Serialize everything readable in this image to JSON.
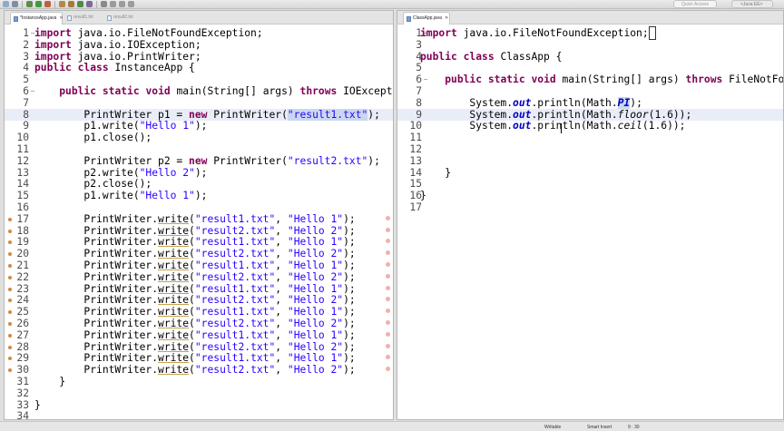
{
  "toolbar": {
    "quick_access_placeholder": "Quick Access",
    "perspective_label": "<Java EE>"
  },
  "left_editor": {
    "tabs": [
      {
        "label": "*InstanceApp.java",
        "active": true,
        "closable": true
      },
      {
        "label": "result1.txt",
        "active": false,
        "closable": false
      },
      {
        "label": "result2.txt",
        "active": false,
        "closable": false
      }
    ],
    "lines": [
      {
        "n": "1",
        "fold": "-",
        "hl": false,
        "ann": false,
        "mark": false,
        "tokens": [
          {
            "t": "import",
            "c": "kw"
          },
          {
            "t": " java.io.FileNotFoundException;"
          }
        ]
      },
      {
        "n": "2",
        "fold": "",
        "hl": false,
        "ann": false,
        "mark": false,
        "tokens": [
          {
            "t": "import",
            "c": "kw"
          },
          {
            "t": " java.io.IOException;"
          }
        ]
      },
      {
        "n": "3",
        "fold": "",
        "hl": false,
        "ann": false,
        "mark": false,
        "tokens": [
          {
            "t": "import",
            "c": "kw"
          },
          {
            "t": " java.io.PrintWriter;"
          }
        ]
      },
      {
        "n": "4",
        "fold": "",
        "hl": false,
        "ann": false,
        "mark": false,
        "tokens": [
          {
            "t": "public",
            "c": "kw"
          },
          {
            "t": " "
          },
          {
            "t": "class",
            "c": "kw"
          },
          {
            "t": " InstanceApp {"
          }
        ]
      },
      {
        "n": "5",
        "fold": "",
        "hl": false,
        "ann": false,
        "mark": false,
        "tokens": []
      },
      {
        "n": "6",
        "fold": "-",
        "hl": false,
        "ann": false,
        "mark": false,
        "tokens": [
          {
            "t": "    "
          },
          {
            "t": "public",
            "c": "kw"
          },
          {
            "t": " "
          },
          {
            "t": "static",
            "c": "kw"
          },
          {
            "t": " "
          },
          {
            "t": "void",
            "c": "kw"
          },
          {
            "t": " main(String[] args) "
          },
          {
            "t": "throws",
            "c": "kw"
          },
          {
            "t": " IOExcepti"
          }
        ]
      },
      {
        "n": "7",
        "fold": "",
        "hl": false,
        "ann": false,
        "mark": false,
        "tokens": []
      },
      {
        "n": "8",
        "fold": "",
        "hl": true,
        "ann": false,
        "mark": false,
        "tokens": [
          {
            "t": "        PrintWriter p1 = "
          },
          {
            "t": "new",
            "c": "kw"
          },
          {
            "t": " PrintWriter("
          },
          {
            "t": "\"result1.txt\"",
            "c": "str sel"
          },
          {
            "t": ");"
          }
        ]
      },
      {
        "n": "9",
        "fold": "",
        "hl": false,
        "ann": false,
        "mark": false,
        "tokens": [
          {
            "t": "        p1.write("
          },
          {
            "t": "\"Hello 1\"",
            "c": "str"
          },
          {
            "t": ");"
          }
        ]
      },
      {
        "n": "10",
        "fold": "",
        "hl": false,
        "ann": false,
        "mark": false,
        "tokens": [
          {
            "t": "        p1.close();"
          }
        ]
      },
      {
        "n": "11",
        "fold": "",
        "hl": false,
        "ann": false,
        "mark": false,
        "tokens": []
      },
      {
        "n": "12",
        "fold": "",
        "hl": false,
        "ann": false,
        "mark": false,
        "tokens": [
          {
            "t": "        PrintWriter p2 = "
          },
          {
            "t": "new",
            "c": "kw"
          },
          {
            "t": " PrintWriter("
          },
          {
            "t": "\"result2.txt\"",
            "c": "str"
          },
          {
            "t": ");"
          }
        ]
      },
      {
        "n": "13",
        "fold": "",
        "hl": false,
        "ann": false,
        "mark": false,
        "tokens": [
          {
            "t": "        p2.write("
          },
          {
            "t": "\"Hello 2\"",
            "c": "str"
          },
          {
            "t": ");"
          }
        ]
      },
      {
        "n": "14",
        "fold": "",
        "hl": false,
        "ann": false,
        "mark": false,
        "tokens": [
          {
            "t": "        p2.close();"
          }
        ]
      },
      {
        "n": "15",
        "fold": "",
        "hl": false,
        "ann": false,
        "mark": false,
        "tokens": [
          {
            "t": "        p1.write("
          },
          {
            "t": "\"Hello 1\"",
            "c": "str"
          },
          {
            "t": ");"
          }
        ]
      },
      {
        "n": "16",
        "fold": "",
        "hl": false,
        "ann": false,
        "mark": false,
        "tokens": []
      },
      {
        "n": "17",
        "fold": "",
        "hl": false,
        "ann": true,
        "mark": true,
        "tokens": [
          {
            "t": "        PrintWriter."
          },
          {
            "t": "write",
            "c": "ul"
          },
          {
            "t": "("
          },
          {
            "t": "\"result1.txt\"",
            "c": "str"
          },
          {
            "t": ", "
          },
          {
            "t": "\"Hello 1\"",
            "c": "str"
          },
          {
            "t": ");"
          }
        ]
      },
      {
        "n": "18",
        "fold": "",
        "hl": false,
        "ann": true,
        "mark": true,
        "tokens": [
          {
            "t": "        PrintWriter."
          },
          {
            "t": "write",
            "c": "ul"
          },
          {
            "t": "("
          },
          {
            "t": "\"result2.txt\"",
            "c": "str"
          },
          {
            "t": ", "
          },
          {
            "t": "\"Hello 2\"",
            "c": "str"
          },
          {
            "t": ");"
          }
        ]
      },
      {
        "n": "19",
        "fold": "",
        "hl": false,
        "ann": true,
        "mark": true,
        "tokens": [
          {
            "t": "        PrintWriter."
          },
          {
            "t": "write",
            "c": "ul"
          },
          {
            "t": "("
          },
          {
            "t": "\"result1.txt\"",
            "c": "str"
          },
          {
            "t": ", "
          },
          {
            "t": "\"Hello 1\"",
            "c": "str"
          },
          {
            "t": ");"
          }
        ]
      },
      {
        "n": "20",
        "fold": "",
        "hl": false,
        "ann": true,
        "mark": true,
        "tokens": [
          {
            "t": "        PrintWriter."
          },
          {
            "t": "write",
            "c": "ul"
          },
          {
            "t": "("
          },
          {
            "t": "\"result2.txt\"",
            "c": "str"
          },
          {
            "t": ", "
          },
          {
            "t": "\"Hello 2\"",
            "c": "str"
          },
          {
            "t": ");"
          }
        ]
      },
      {
        "n": "21",
        "fold": "",
        "hl": false,
        "ann": true,
        "mark": true,
        "tokens": [
          {
            "t": "        PrintWriter."
          },
          {
            "t": "write",
            "c": "ul"
          },
          {
            "t": "("
          },
          {
            "t": "\"result1.txt\"",
            "c": "str"
          },
          {
            "t": ", "
          },
          {
            "t": "\"Hello 1\"",
            "c": "str"
          },
          {
            "t": ");"
          }
        ]
      },
      {
        "n": "22",
        "fold": "",
        "hl": false,
        "ann": true,
        "mark": true,
        "tokens": [
          {
            "t": "        PrintWriter."
          },
          {
            "t": "write",
            "c": "ul"
          },
          {
            "t": "("
          },
          {
            "t": "\"result2.txt\"",
            "c": "str"
          },
          {
            "t": ", "
          },
          {
            "t": "\"Hello 2\"",
            "c": "str"
          },
          {
            "t": ");"
          }
        ]
      },
      {
        "n": "23",
        "fold": "",
        "hl": false,
        "ann": true,
        "mark": true,
        "tokens": [
          {
            "t": "        PrintWriter."
          },
          {
            "t": "write",
            "c": "ul"
          },
          {
            "t": "("
          },
          {
            "t": "\"result1.txt\"",
            "c": "str"
          },
          {
            "t": ", "
          },
          {
            "t": "\"Hello 1\"",
            "c": "str"
          },
          {
            "t": ");"
          }
        ]
      },
      {
        "n": "24",
        "fold": "",
        "hl": false,
        "ann": true,
        "mark": true,
        "tokens": [
          {
            "t": "        PrintWriter."
          },
          {
            "t": "write",
            "c": "ul"
          },
          {
            "t": "("
          },
          {
            "t": "\"result2.txt\"",
            "c": "str"
          },
          {
            "t": ", "
          },
          {
            "t": "\"Hello 2\"",
            "c": "str"
          },
          {
            "t": ");"
          }
        ]
      },
      {
        "n": "25",
        "fold": "",
        "hl": false,
        "ann": true,
        "mark": true,
        "tokens": [
          {
            "t": "        PrintWriter."
          },
          {
            "t": "write",
            "c": "ul"
          },
          {
            "t": "("
          },
          {
            "t": "\"result1.txt\"",
            "c": "str"
          },
          {
            "t": ", "
          },
          {
            "t": "\"Hello 1\"",
            "c": "str"
          },
          {
            "t": ");"
          }
        ]
      },
      {
        "n": "26",
        "fold": "",
        "hl": false,
        "ann": true,
        "mark": true,
        "tokens": [
          {
            "t": "        PrintWriter."
          },
          {
            "t": "write",
            "c": "ul"
          },
          {
            "t": "("
          },
          {
            "t": "\"result2.txt\"",
            "c": "str"
          },
          {
            "t": ", "
          },
          {
            "t": "\"Hello 2\"",
            "c": "str"
          },
          {
            "t": ");"
          }
        ]
      },
      {
        "n": "27",
        "fold": "",
        "hl": false,
        "ann": true,
        "mark": true,
        "tokens": [
          {
            "t": "        PrintWriter."
          },
          {
            "t": "write",
            "c": "ul"
          },
          {
            "t": "("
          },
          {
            "t": "\"result1.txt\"",
            "c": "str"
          },
          {
            "t": ", "
          },
          {
            "t": "\"Hello 1\"",
            "c": "str"
          },
          {
            "t": ");"
          }
        ]
      },
      {
        "n": "28",
        "fold": "",
        "hl": false,
        "ann": true,
        "mark": true,
        "tokens": [
          {
            "t": "        PrintWriter."
          },
          {
            "t": "write",
            "c": "ul"
          },
          {
            "t": "("
          },
          {
            "t": "\"result2.txt\"",
            "c": "str"
          },
          {
            "t": ", "
          },
          {
            "t": "\"Hello 2\"",
            "c": "str"
          },
          {
            "t": ");"
          }
        ]
      },
      {
        "n": "29",
        "fold": "",
        "hl": false,
        "ann": true,
        "mark": true,
        "tokens": [
          {
            "t": "        PrintWriter."
          },
          {
            "t": "write",
            "c": "ul"
          },
          {
            "t": "("
          },
          {
            "t": "\"result1.txt\"",
            "c": "str"
          },
          {
            "t": ", "
          },
          {
            "t": "\"Hello 1\"",
            "c": "str"
          },
          {
            "t": ");"
          }
        ]
      },
      {
        "n": "30",
        "fold": "",
        "hl": false,
        "ann": true,
        "mark": true,
        "tokens": [
          {
            "t": "        PrintWriter."
          },
          {
            "t": "write",
            "c": "ul"
          },
          {
            "t": "("
          },
          {
            "t": "\"result2.txt\"",
            "c": "str"
          },
          {
            "t": ", "
          },
          {
            "t": "\"Hello 2\"",
            "c": "str"
          },
          {
            "t": ");"
          }
        ]
      },
      {
        "n": "31",
        "fold": "",
        "hl": false,
        "ann": false,
        "mark": false,
        "tokens": [
          {
            "t": "    }"
          }
        ]
      },
      {
        "n": "32",
        "fold": "",
        "hl": false,
        "ann": false,
        "mark": false,
        "tokens": []
      },
      {
        "n": "33",
        "fold": "",
        "hl": false,
        "ann": false,
        "mark": false,
        "tokens": [
          {
            "t": "}"
          }
        ]
      },
      {
        "n": "34",
        "fold": "",
        "hl": false,
        "ann": false,
        "mark": false,
        "tokens": []
      }
    ]
  },
  "right_editor": {
    "tabs": [
      {
        "label": "ClassApp.java",
        "active": true,
        "closable": true
      }
    ],
    "lines": [
      {
        "n": "1",
        "fold": "+",
        "hl": false,
        "ann": false,
        "mark": false,
        "tokens": [
          {
            "t": "import",
            "c": "kw"
          },
          {
            "t": " java.io.FileNotFoundException;"
          },
          {
            "t": " ",
            "c": "cursor-box"
          }
        ]
      },
      {
        "n": "3",
        "fold": "",
        "hl": false,
        "ann": false,
        "mark": false,
        "tokens": []
      },
      {
        "n": "4",
        "fold": "",
        "hl": false,
        "ann": false,
        "mark": false,
        "tokens": [
          {
            "t": "public",
            "c": "kw"
          },
          {
            "t": " "
          },
          {
            "t": "class",
            "c": "kw"
          },
          {
            "t": " ClassApp {"
          }
        ]
      },
      {
        "n": "5",
        "fold": "",
        "hl": false,
        "ann": false,
        "mark": false,
        "tokens": []
      },
      {
        "n": "6",
        "fold": "-",
        "hl": false,
        "ann": false,
        "mark": false,
        "tokens": [
          {
            "t": "    "
          },
          {
            "t": "public",
            "c": "kw"
          },
          {
            "t": " "
          },
          {
            "t": "static",
            "c": "kw"
          },
          {
            "t": " "
          },
          {
            "t": "void",
            "c": "kw"
          },
          {
            "t": " main(String[] args) "
          },
          {
            "t": "throws",
            "c": "kw"
          },
          {
            "t": " FileNotFo"
          }
        ]
      },
      {
        "n": "7",
        "fold": "",
        "hl": false,
        "ann": false,
        "mark": false,
        "tokens": []
      },
      {
        "n": "8",
        "fold": "",
        "hl": false,
        "ann": false,
        "mark": false,
        "tokens": [
          {
            "t": "        System."
          },
          {
            "t": "out",
            "c": "fld"
          },
          {
            "t": ".println(Math."
          },
          {
            "t": "PI",
            "c": "fld sel"
          },
          {
            "t": ");"
          }
        ]
      },
      {
        "n": "9",
        "fold": "",
        "hl": true,
        "ann": false,
        "mark": false,
        "tokens": [
          {
            "t": "        System."
          },
          {
            "t": "out",
            "c": "fld"
          },
          {
            "t": ".println(Math."
          },
          {
            "t": "floor",
            "c": "it"
          },
          {
            "t": "(1.6));"
          }
        ]
      },
      {
        "n": "10",
        "fold": "",
        "hl": false,
        "ann": false,
        "mark": false,
        "tokens": [
          {
            "t": "        System."
          },
          {
            "t": "out",
            "c": "fld"
          },
          {
            "t": ".println(Math."
          },
          {
            "t": "ceil",
            "c": "it"
          },
          {
            "t": "(1.6));"
          }
        ]
      },
      {
        "n": "11",
        "fold": "",
        "hl": false,
        "ann": false,
        "mark": false,
        "tokens": []
      },
      {
        "n": "12",
        "fold": "",
        "hl": false,
        "ann": false,
        "mark": false,
        "tokens": []
      },
      {
        "n": "13",
        "fold": "",
        "hl": false,
        "ann": false,
        "mark": false,
        "tokens": []
      },
      {
        "n": "14",
        "fold": "",
        "hl": false,
        "ann": false,
        "mark": false,
        "tokens": [
          {
            "t": "    }"
          }
        ]
      },
      {
        "n": "15",
        "fold": "",
        "hl": false,
        "ann": false,
        "mark": false,
        "tokens": []
      },
      {
        "n": "16",
        "fold": "",
        "hl": false,
        "ann": false,
        "mark": false,
        "tokens": [
          {
            "t": "}"
          }
        ]
      },
      {
        "n": "17",
        "fold": "",
        "hl": false,
        "ann": false,
        "mark": false,
        "tokens": []
      }
    ]
  },
  "statusbar": {
    "writable": "Writable",
    "insert_mode": "Smart Insert",
    "position": "9 : 30"
  },
  "colors": {
    "keyword": "#7f0055",
    "string": "#2a00ff",
    "field": "#0000c0",
    "current_line": "#e8edf7"
  }
}
